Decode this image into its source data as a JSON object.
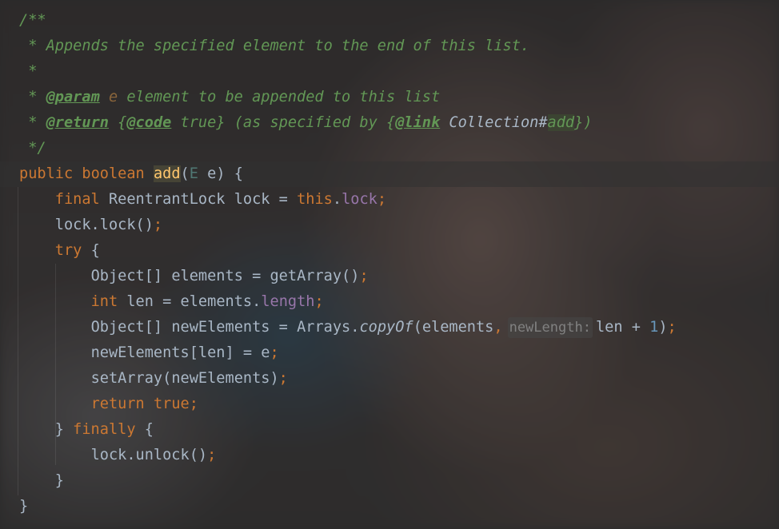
{
  "editor": {
    "doc": {
      "open": "/**",
      "star": " *",
      "summary": " Appends the specified element to the end of this list.",
      "param_tag": "@param",
      "param_name": " e",
      "param_desc": " element to be appended to this list",
      "return_tag": "@return",
      "return_open": " {",
      "code_tag": "@code",
      "return_mid": " true} (as specified by {",
      "link_tag": "@link",
      "link_ref": " Collection#",
      "link_member": "add",
      "return_close": "})",
      "close": " */"
    },
    "code": {
      "public": "public",
      "boolean": "boolean",
      "method_name": "add",
      "type_param": "E",
      "param_e": "e",
      "final": "final",
      "lock_type": "ReentrantLock",
      "lock_var": "lock",
      "this": "this",
      "lock_field": "lock",
      "lock_call": "lock.lock()",
      "try": "try",
      "object_arr": "Object[]",
      "elements": "elements",
      "get_array": "getArray",
      "int": "int",
      "len": "len",
      "length_field": "length",
      "new_elements": "newElements",
      "arrays": "Arrays",
      "copy_of": "copyOf",
      "hint_new_length": "newLength:",
      "one": "1",
      "new_elements_index": "newElements[len]",
      "set_array": "setArray",
      "return": "return",
      "true": "true",
      "finally": "finally",
      "unlock_call": "lock.unlock()"
    }
  }
}
